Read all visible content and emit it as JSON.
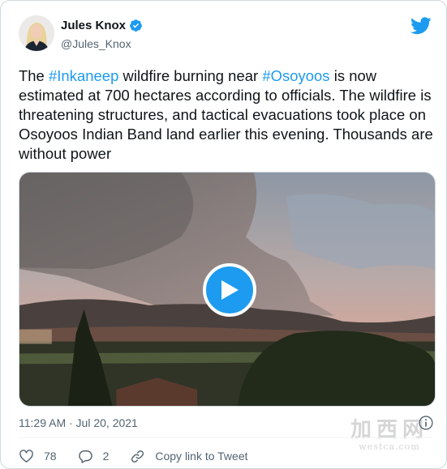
{
  "author": {
    "name": "Jules Knox",
    "handle": "@Jules_Knox",
    "verified": true,
    "avatar_icon": "avatar-photo"
  },
  "tweet": {
    "text_segments": [
      {
        "text": "The ",
        "type": "text"
      },
      {
        "text": "#Inkaneep",
        "type": "hashtag"
      },
      {
        "text": " wildfire burning near ",
        "type": "text"
      },
      {
        "text": "#Osoyoos",
        "type": "hashtag"
      },
      {
        "text": " is now estimated at 700 hectares according to officials. The wildfire is threatening structures, and tactical evacuations took place on Osoyoos Indian Band land earlier this evening. Thousands are without power",
        "type": "text"
      }
    ]
  },
  "media": {
    "type": "video",
    "play_icon": "play-icon"
  },
  "timestamp": "11:29 AM · Jul 20, 2021",
  "actions": {
    "like_count": "78",
    "reply_count": "2",
    "copy_link_label": "Copy link to Tweet"
  },
  "watermark": {
    "big": "加西网",
    "small": "westca.com"
  },
  "colors": {
    "accent": "#1d9bf0",
    "text": "#0f1419",
    "secondary": "#536471"
  }
}
